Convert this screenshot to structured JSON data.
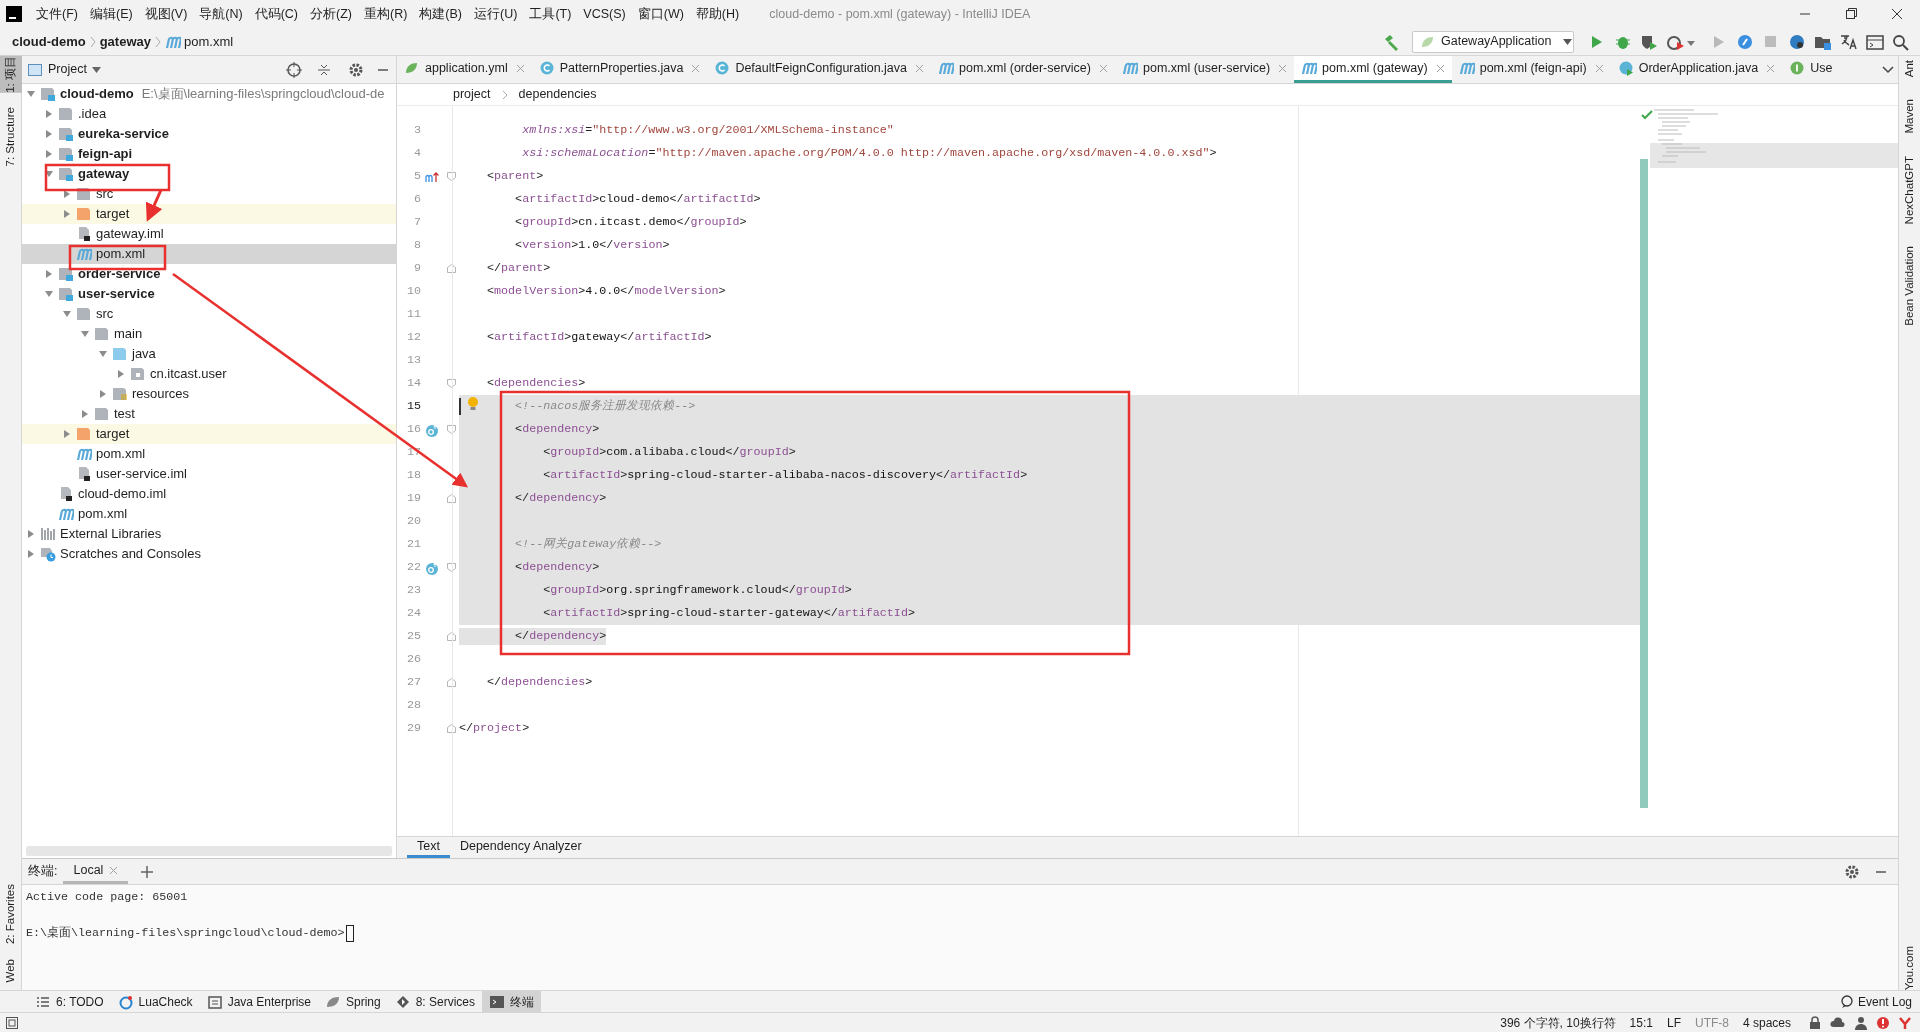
{
  "window": {
    "title": "cloud-demo - pom.xml (gateway) - IntelliJ IDEA"
  },
  "menu": [
    "文件(F)",
    "编辑(E)",
    "视图(V)",
    "导航(N)",
    "代码(C)",
    "分析(Z)",
    "重构(R)",
    "构建(B)",
    "运行(U)",
    "工具(T)",
    "VCS(S)",
    "窗口(W)",
    "帮助(H)"
  ],
  "breadcrumb": [
    {
      "label": "cloud-demo",
      "kind": "module"
    },
    {
      "label": "gateway",
      "kind": "module"
    },
    {
      "label": "pom.xml",
      "kind": "maven"
    }
  ],
  "toolbar": {
    "run_configuration": "GatewayApplication"
  },
  "left_strip": {
    "top": [
      {
        "label": "1: 项目",
        "selected": true
      },
      {
        "label": "7: Structure",
        "selected": false
      }
    ],
    "bottom": [
      {
        "label": "2: Favorites",
        "selected": false
      },
      {
        "label": "Web",
        "selected": false
      }
    ]
  },
  "right_strip": {
    "top": [
      "Ant",
      "Maven",
      "NexChatGPT",
      "Bean Validation"
    ],
    "bottom": [
      "You.com"
    ]
  },
  "project_panel": {
    "title": "Project",
    "tree": [
      {
        "label": "cloud-demo",
        "hint": "E:\\桌面\\learning-files\\springcloud\\cloud-de",
        "kind": "module",
        "expanded": true,
        "selected": false,
        "children": [
          {
            "label": ".idea",
            "kind": "folder",
            "expanded": false,
            "selected": false
          },
          {
            "label": "eureka-service",
            "kind": "module",
            "expanded": false,
            "selected": false
          },
          {
            "label": "feign-api",
            "kind": "module",
            "expanded": false,
            "selected": false
          },
          {
            "label": "gateway",
            "kind": "module",
            "expanded": true,
            "selected": false,
            "children": [
              {
                "label": "src",
                "kind": "folder",
                "expanded": false,
                "selected": false
              },
              {
                "label": "target",
                "kind": "excluded",
                "expanded": false,
                "selected": false
              },
              {
                "label": "gateway.iml",
                "kind": "iml",
                "selected": false
              },
              {
                "label": "pom.xml",
                "kind": "maven",
                "selected": true
              }
            ]
          },
          {
            "label": "order-service",
            "kind": "module",
            "expanded": false,
            "selected": false
          },
          {
            "label": "user-service",
            "kind": "module",
            "expanded": true,
            "selected": false,
            "children": [
              {
                "label": "src",
                "kind": "folder",
                "expanded": true,
                "selected": false,
                "children": [
                  {
                    "label": "main",
                    "kind": "folder",
                    "expanded": true,
                    "selected": false,
                    "children": [
                      {
                        "label": "java",
                        "kind": "source",
                        "expanded": true,
                        "selected": false,
                        "children": [
                          {
                            "label": "cn.itcast.user",
                            "kind": "package",
                            "expanded": false,
                            "selected": false
                          }
                        ]
                      },
                      {
                        "label": "resources",
                        "kind": "resources",
                        "expanded": false,
                        "selected": false
                      }
                    ]
                  },
                  {
                    "label": "test",
                    "kind": "folder",
                    "expanded": false,
                    "selected": false
                  }
                ]
              },
              {
                "label": "target",
                "kind": "excluded",
                "expanded": false,
                "selected": false
              },
              {
                "label": "pom.xml",
                "kind": "maven",
                "selected": false
              },
              {
                "label": "user-service.iml",
                "kind": "iml",
                "selected": false
              }
            ]
          },
          {
            "label": "cloud-demo.iml",
            "kind": "iml",
            "selected": false
          },
          {
            "label": "pom.xml",
            "kind": "maven",
            "selected": false
          }
        ]
      },
      {
        "label": "External Libraries",
        "kind": "libraries",
        "expanded": false,
        "selected": false
      },
      {
        "label": "Scratches and Consoles",
        "kind": "scratches",
        "expanded": false,
        "selected": false
      }
    ]
  },
  "editor": {
    "tabs": [
      {
        "label": "application.yml",
        "kind": "yaml",
        "selected": false,
        "closable": true
      },
      {
        "label": "PatternProperties.java",
        "kind": "class",
        "selected": false,
        "closable": true
      },
      {
        "label": "DefaultFeignConfiguration.java",
        "kind": "class",
        "selected": false,
        "closable": true
      },
      {
        "label": "pom.xml (order-service)",
        "kind": "maven",
        "selected": false,
        "closable": true
      },
      {
        "label": "pom.xml (user-service)",
        "kind": "maven",
        "selected": false,
        "closable": true
      },
      {
        "label": "pom.xml (gateway)",
        "kind": "maven",
        "selected": true,
        "closable": true
      },
      {
        "label": "pom.xml (feign-api)",
        "kind": "maven",
        "selected": false,
        "closable": true
      },
      {
        "label": "OrderApplication.java",
        "kind": "app",
        "selected": false,
        "closable": true
      },
      {
        "label": "Use",
        "kind": "interface",
        "selected": false,
        "closable": false
      }
    ],
    "path": [
      "project",
      "dependencies"
    ],
    "lines": [
      {
        "number": "3",
        "kind": "xml",
        "text": "         xmlns:xsi=\"http://www.w3.org/2001/XMLSchema-instance\"",
        "selected": false,
        "current": false
      },
      {
        "number": "4",
        "kind": "xml",
        "text": "         xsi:schemaLocation=\"http://maven.apache.org/POM/4.0.0 http://maven.apache.org/xsd/maven-4.0.0.xsd\">",
        "selected": false,
        "current": false
      },
      {
        "number": "5",
        "kind": "xml",
        "text": "    <parent>",
        "selected": false,
        "current": false,
        "gutter": {
          "kind": "maven-parent"
        },
        "fold": {
          "kind": "start"
        }
      },
      {
        "number": "6",
        "kind": "xml",
        "text": "        <artifactId>cloud-demo</artifactId>",
        "selected": false,
        "current": false
      },
      {
        "number": "7",
        "kind": "xml",
        "text": "        <groupId>cn.itcast.demo</groupId>",
        "selected": false,
        "current": false
      },
      {
        "number": "8",
        "kind": "xml",
        "text": "        <version>1.0</version>",
        "selected": false,
        "current": false
      },
      {
        "number": "9",
        "kind": "xml",
        "text": "    </parent>",
        "selected": false,
        "current": false,
        "fold": {
          "kind": "end"
        }
      },
      {
        "number": "10",
        "kind": "xml",
        "text": "    <modelVersion>4.0.0</modelVersion>",
        "selected": false,
        "current": false
      },
      {
        "number": "11",
        "current": false
      },
      {
        "number": "12",
        "kind": "xml",
        "text": "    <artifactId>gateway</artifactId>",
        "selected": false,
        "current": false
      },
      {
        "number": "13",
        "current": false
      },
      {
        "number": "14",
        "kind": "xml",
        "text": "    <dependencies>",
        "selected": false,
        "current": false,
        "fold": {
          "kind": "start"
        }
      },
      {
        "number": "15",
        "kind": "comment",
        "text": "        <!--nacos服务注册发现依赖-->",
        "selected": true,
        "current": true,
        "gutter": {
          "kind": "bulb"
        }
      },
      {
        "number": "16",
        "kind": "xml",
        "text": "        <dependency>",
        "selected": true,
        "current": false,
        "gutter": {
          "kind": "override"
        },
        "fold": {
          "kind": "start"
        }
      },
      {
        "number": "17",
        "kind": "xml",
        "text": "            <groupId>com.alibaba.cloud</groupId>",
        "selected": true,
        "current": false
      },
      {
        "number": "18",
        "kind": "xml",
        "text": "            <artifactId>spring-cloud-starter-alibaba-nacos-discovery</artifactId>",
        "selected": true,
        "current": false
      },
      {
        "number": "19",
        "kind": "xml",
        "text": "        </dependency>",
        "selected": true,
        "current": false,
        "fold": {
          "kind": "end"
        }
      },
      {
        "number": "20",
        "selected": true,
        "current": false
      },
      {
        "number": "21",
        "kind": "comment",
        "text": "        <!--网关gateway依赖-->",
        "selected": true,
        "current": false
      },
      {
        "number": "22",
        "kind": "xml",
        "text": "        <dependency>",
        "selected": true,
        "current": false,
        "gutter": {
          "kind": "override"
        },
        "fold": {
          "kind": "start"
        }
      },
      {
        "number": "23",
        "kind": "xml",
        "text": "            <groupId>org.springframework.cloud</groupId>",
        "selected": true,
        "current": false
      },
      {
        "number": "24",
        "kind": "xml",
        "text": "            <artifactId>spring-cloud-starter-gateway</artifactId>",
        "selected": true,
        "current": false
      },
      {
        "number": "25",
        "kind": "xml",
        "text": "        </dependency>",
        "selected": true,
        "current": false,
        "fold": {
          "kind": "end"
        }
      },
      {
        "number": "26",
        "current": false
      },
      {
        "number": "27",
        "kind": "xml",
        "text": "    </dependencies>",
        "selected": false,
        "current": false,
        "fold": {
          "kind": "end"
        }
      },
      {
        "number": "28",
        "current": false
      },
      {
        "number": "29",
        "kind": "xml",
        "text": "</project>",
        "selected": false,
        "current": false,
        "fold": {
          "kind": "end"
        }
      }
    ],
    "view_tabs": [
      {
        "label": "Text",
        "selected": true
      },
      {
        "label": "Dependency Analyzer",
        "selected": false
      }
    ]
  },
  "terminal": {
    "title": "终端:",
    "tabs": [
      {
        "label": "Local",
        "selected": true
      }
    ],
    "lines": [
      {
        "text": "Active code page: 65001",
        "cursor": false
      },
      {
        "text": "E:\\桌面\\learning-files\\springcloud\\cloud-demo>",
        "cursor": true
      }
    ]
  },
  "tool_windows": [
    {
      "label": "6: TODO",
      "kind": "list",
      "selected": false
    },
    {
      "label": "LuaCheck",
      "kind": "lua",
      "selected": false
    },
    {
      "label": "Java Enterprise",
      "kind": "enterprise",
      "selected": false
    },
    {
      "label": "Spring",
      "kind": "spring",
      "selected": false
    },
    {
      "label": "8: Services",
      "kind": "services",
      "selected": false
    },
    {
      "label": "终端",
      "kind": "terminal",
      "selected": true
    }
  ],
  "event_log": "Event Log",
  "status_bar": [
    "396 个字符, 10换行符",
    "15:1",
    "LF",
    "UTF-8",
    "4 spaces"
  ]
}
